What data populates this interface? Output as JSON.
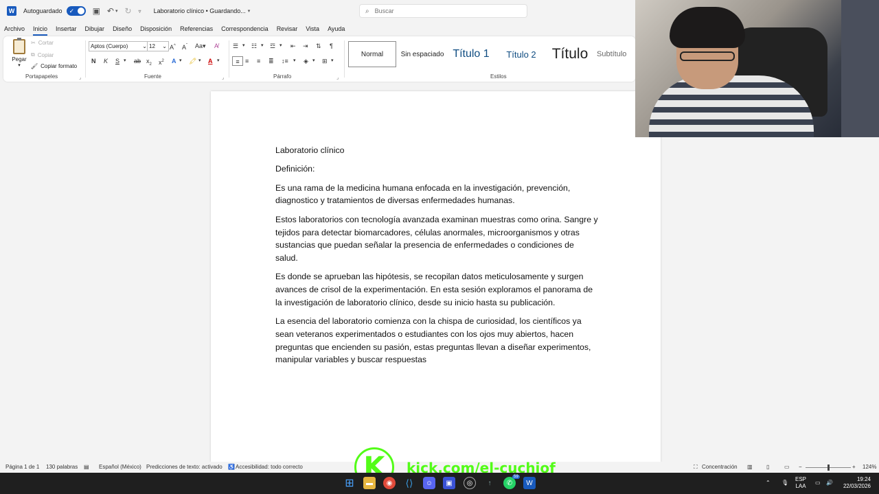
{
  "titlebar": {
    "app_icon": "word-icon",
    "autosave_label": "Autoguardado",
    "doc_title": "Laboratorio clínico • Guardando...",
    "search_placeholder": "Buscar"
  },
  "tabs": [
    "Archivo",
    "Inicio",
    "Insertar",
    "Dibujar",
    "Diseño",
    "Disposición",
    "Referencias",
    "Correspondencia",
    "Revisar",
    "Vista",
    "Ayuda"
  ],
  "active_tab": "Inicio",
  "ribbon": {
    "clipboard": {
      "paste": "Pegar",
      "cut": "Cortar",
      "copy": "Copiar",
      "format_painter": "Copiar formato",
      "group": "Portapapeles"
    },
    "font": {
      "family": "Aptos (Cuerpo)",
      "size": "12",
      "group": "Fuente"
    },
    "paragraph": {
      "group": "Párrafo"
    },
    "styles": {
      "items": [
        "Normal",
        "Sin espaciado",
        "Título 1",
        "Título 2",
        "Título",
        "Subtítulo"
      ],
      "group": "Estilos"
    }
  },
  "document": {
    "paragraphs": [
      "Laboratorio clínico",
      "Definición:",
      "Es una rama de la medicina humana enfocada en la investigación, prevención, diagnostico y tratamientos de diversas enfermedades humanas.",
      "Estos laboratorios con tecnología avanzada examinan muestras como orina. Sangre y tejidos para detectar biomarcadores, células anormales, microorganismos y otras sustancias que puedan señalar la presencia de enfermedades o condiciones de salud.",
      "Es donde se aprueban las hipótesis, se recopilan datos meticulosamente y surgen avances de crisol de la experimentación. En esta sesión exploramos el panorama de la investigación de laboratorio clínico, desde su inicio hasta su publicación.",
      "La esencia del laboratorio comienza con la chispa de curiosidad, los científicos ya sean veteranos experimentados o estudiantes con los ojos muy abiertos, hacen preguntas que encienden su pasión, estas preguntas llevan a diseñar experimentos, manipular variables  y buscar respuestas"
    ]
  },
  "statusbar": {
    "page": "Página 1 de 1",
    "words": "130 palabras",
    "language": "Español (México)",
    "predictions": "Predicciones de texto: activado",
    "accessibility": "Accesibilidad: todo correcto",
    "focus": "Concentración",
    "zoom": "124%",
    "zoom_level": 1.24
  },
  "overlay": {
    "kick_url": "kick.com/el-cuchiof",
    "kick_letter": "K",
    "kick_color": "#53fc18"
  },
  "taskbar": {
    "lang_top": "ESP",
    "lang_bottom": "LAA",
    "time": "19:24",
    "date": "22/03/2026",
    "whatsapp_badge": "59"
  },
  "colors": {
    "accent": "#185abd",
    "taskbar": "#1f1f1f"
  }
}
